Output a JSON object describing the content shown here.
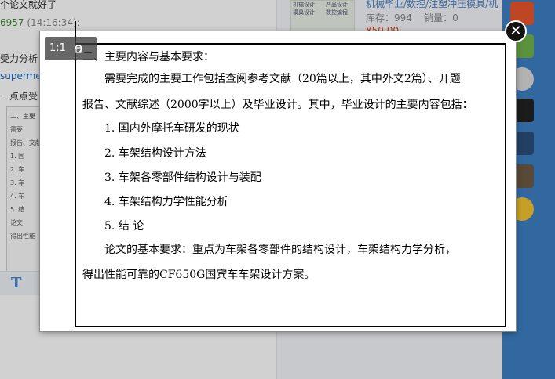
{
  "background": {
    "chat": {
      "line1": "个论文就好了",
      "sender": "6957",
      "time": "(14:16:34):",
      "line3": "受力分析",
      "user": "superme",
      "line5": "一点点受"
    },
    "thumb_lines": [
      "二、主要",
      "需要",
      "报告、文献",
      "1. 国",
      "2. 车",
      "3. 车",
      "4. 车",
      "5. 结",
      "论文",
      "得出性能"
    ],
    "shop": {
      "img_text_1": "机械设计",
      "img_text_2": "产品设计",
      "img_text_3": "模具设计",
      "img_text_4": "数控编程",
      "title": "机械毕业/数控/注塑冲压模具/机",
      "stock_label": "库存：994",
      "sold_label": "销量：0",
      "price": "¥50.00"
    }
  },
  "viewer": {
    "ratio_label": "1:1",
    "close_symbol": "✕"
  },
  "document": {
    "heading": "二、主要内容与基本要求：",
    "para1_l1": "需要完成的主要工作包括查阅参考文献（20篇以上，其中外文2篇）、开题",
    "para1_l2": "报告、文献综述（2000字以上）及毕业设计。其中，毕业设计的主要内容包括：",
    "items": [
      "1. 国内外摩托车研发的现状",
      "2. 车架结构设计方法",
      "3. 车架各零部件结构设计与装配",
      "4. 车架结构力学性能分析",
      "5. 结 论"
    ],
    "para2_l1": "论文的基本要求：重点为车架各零部件的结构设计，车架结构力学分析，",
    "para2_l2": "得出性能可靠的CF650G国宾车车架设计方案。"
  },
  "colors": {
    "sidebar": "#3d7fc4",
    "link": "#1a6dc2",
    "price": "#e0431b"
  }
}
